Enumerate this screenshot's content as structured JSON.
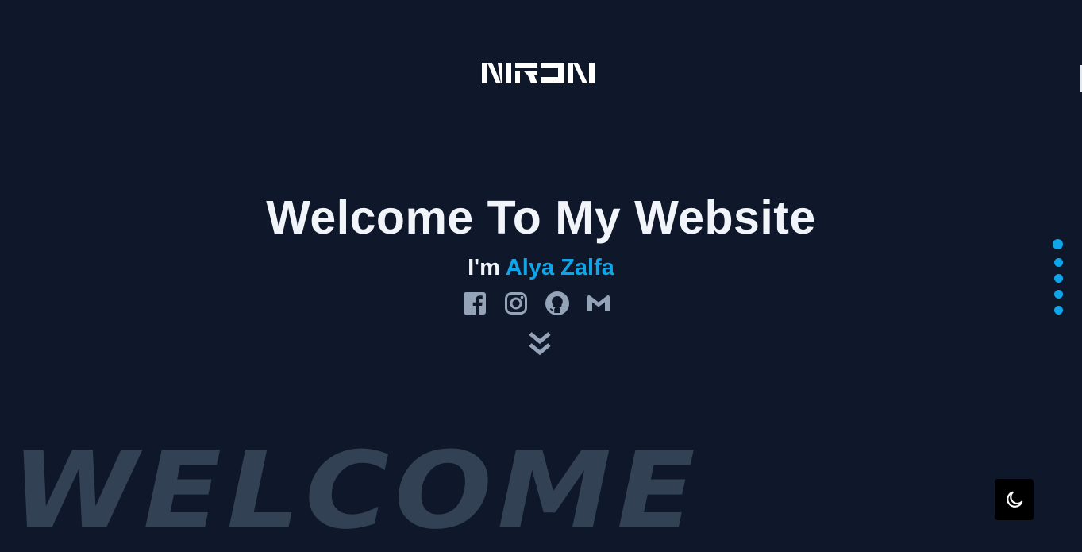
{
  "logo": {
    "text": "NIRJN",
    "icon": "nirjn-logo"
  },
  "hero": {
    "title": "Welcome To My Website",
    "intro_prefix": "I'm",
    "name": "Alya Zalfa"
  },
  "socials": [
    {
      "label": "Facebook",
      "icon": "facebook-icon"
    },
    {
      "label": "Instagram",
      "icon": "instagram-icon"
    },
    {
      "label": "GitHub",
      "icon": "github-icon"
    },
    {
      "label": "Gmail",
      "icon": "gmail-icon"
    }
  ],
  "scroll_down": {
    "icon": "chevron-double-down-icon"
  },
  "section_dots": {
    "count": 5,
    "active_index": 0
  },
  "background_word": "WELCOME",
  "theme_toggle": {
    "icon": "moon-icon"
  },
  "colors": {
    "background": "#0f172a",
    "accent": "#0ea5e9",
    "text": "#f1f5f9",
    "muted_icon": "#94a3b8",
    "watermark": "#334155",
    "toggle_bg": "#000000"
  }
}
